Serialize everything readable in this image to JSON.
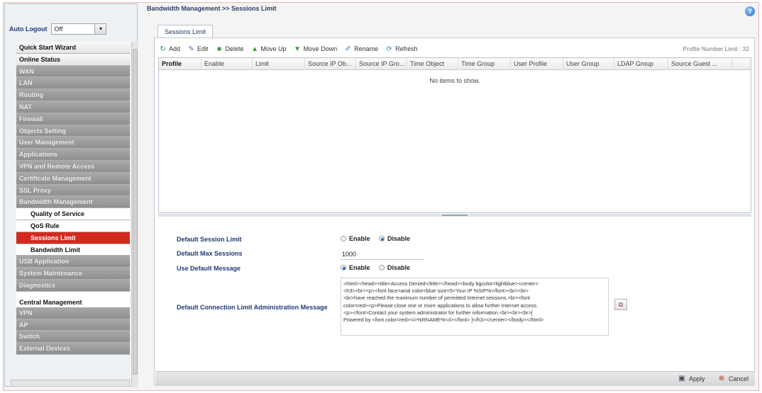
{
  "sidebar": {
    "auto_logout_label": "Auto Logout",
    "auto_logout_value": "Off",
    "items": [
      {
        "label": "Quick Start Wizard",
        "style": "light"
      },
      {
        "label": "Online Status",
        "style": "light"
      },
      {
        "label": "WAN",
        "style": "grey"
      },
      {
        "label": "LAN",
        "style": "grey"
      },
      {
        "label": "Routing",
        "style": "grey"
      },
      {
        "label": "NAT",
        "style": "grey"
      },
      {
        "label": "Firewall",
        "style": "grey"
      },
      {
        "label": "Objects Setting",
        "style": "grey"
      },
      {
        "label": "User Management",
        "style": "grey"
      },
      {
        "label": "Applications",
        "style": "grey"
      },
      {
        "label": "VPN and Remote Access",
        "style": "grey"
      },
      {
        "label": "Certificate Management",
        "style": "grey"
      },
      {
        "label": "SSL Proxy",
        "style": "grey"
      },
      {
        "label": "Bandwidth Management",
        "style": "grey"
      },
      {
        "label": "Quality of Service",
        "style": "sub"
      },
      {
        "label": "QoS Rule",
        "style": "sub"
      },
      {
        "label": "Sessions Limit",
        "style": "active"
      },
      {
        "label": "Bandwidth Limit",
        "style": "sub"
      },
      {
        "label": "USB Application",
        "style": "grey"
      },
      {
        "label": "System Maintenance",
        "style": "grey"
      },
      {
        "label": "Diagnostics",
        "style": "grey"
      },
      {
        "label": "Central Management",
        "style": "sect"
      },
      {
        "label": "VPN",
        "style": "grey"
      },
      {
        "label": "AP",
        "style": "grey"
      },
      {
        "label": "Switch",
        "style": "grey"
      },
      {
        "label": "External Devices",
        "style": "grey"
      }
    ]
  },
  "header": {
    "breadcrumb": "Bandwidth Management >> Sessions Limit",
    "tab": "Sessions Limit"
  },
  "toolbar": {
    "add": "Add",
    "edit": "Edit",
    "delete": "Delete",
    "move_up": "Move Up",
    "move_down": "Move Down",
    "rename": "Rename",
    "refresh": "Refresh",
    "profile_limit": "Profile Number Limit : 32"
  },
  "grid": {
    "columns": [
      "Profile",
      "Enable",
      "Limit",
      "Source IP Ob...",
      "Source IP Gro...",
      "Time Object",
      "Time Group",
      "User Profile",
      "User Group",
      "LDAP Group",
      "Source Guest ..."
    ],
    "empty_text": "No items to show."
  },
  "form": {
    "default_session_limit": {
      "label": "Default Session Limit",
      "options": [
        "Enable",
        "Disable"
      ],
      "selected": "Disable"
    },
    "default_max_sessions": {
      "label": "Default Max Sessions",
      "value": "1000"
    },
    "use_default_message": {
      "label": "Use Default Message",
      "options": [
        "Enable",
        "Disable"
      ],
      "selected": "Enable"
    },
    "admin_message": {
      "label": "Default Connection Limit Administration Message",
      "lines": [
        "<html><head><title>Access Denied</title></head><body bgcolor=lightblue><center>",
        "<h3><br><p><font face=arial color=blue size=5>Your IP %SIP%</font><br><br>",
        "<br>have reached the maximum number of permitted Internet sessions.<br><font",
        "color=red><p>Please close one or more applications to allow further Internet access.",
        "<p></font>Contact your system administrator for further information.<br><br><br>[",
        "Powered by <font color=red><i>%RNAME%</i></font> ]</h3></center></body></html>"
      ]
    }
  },
  "footer": {
    "apply": "Apply",
    "cancel": "Cancel"
  }
}
